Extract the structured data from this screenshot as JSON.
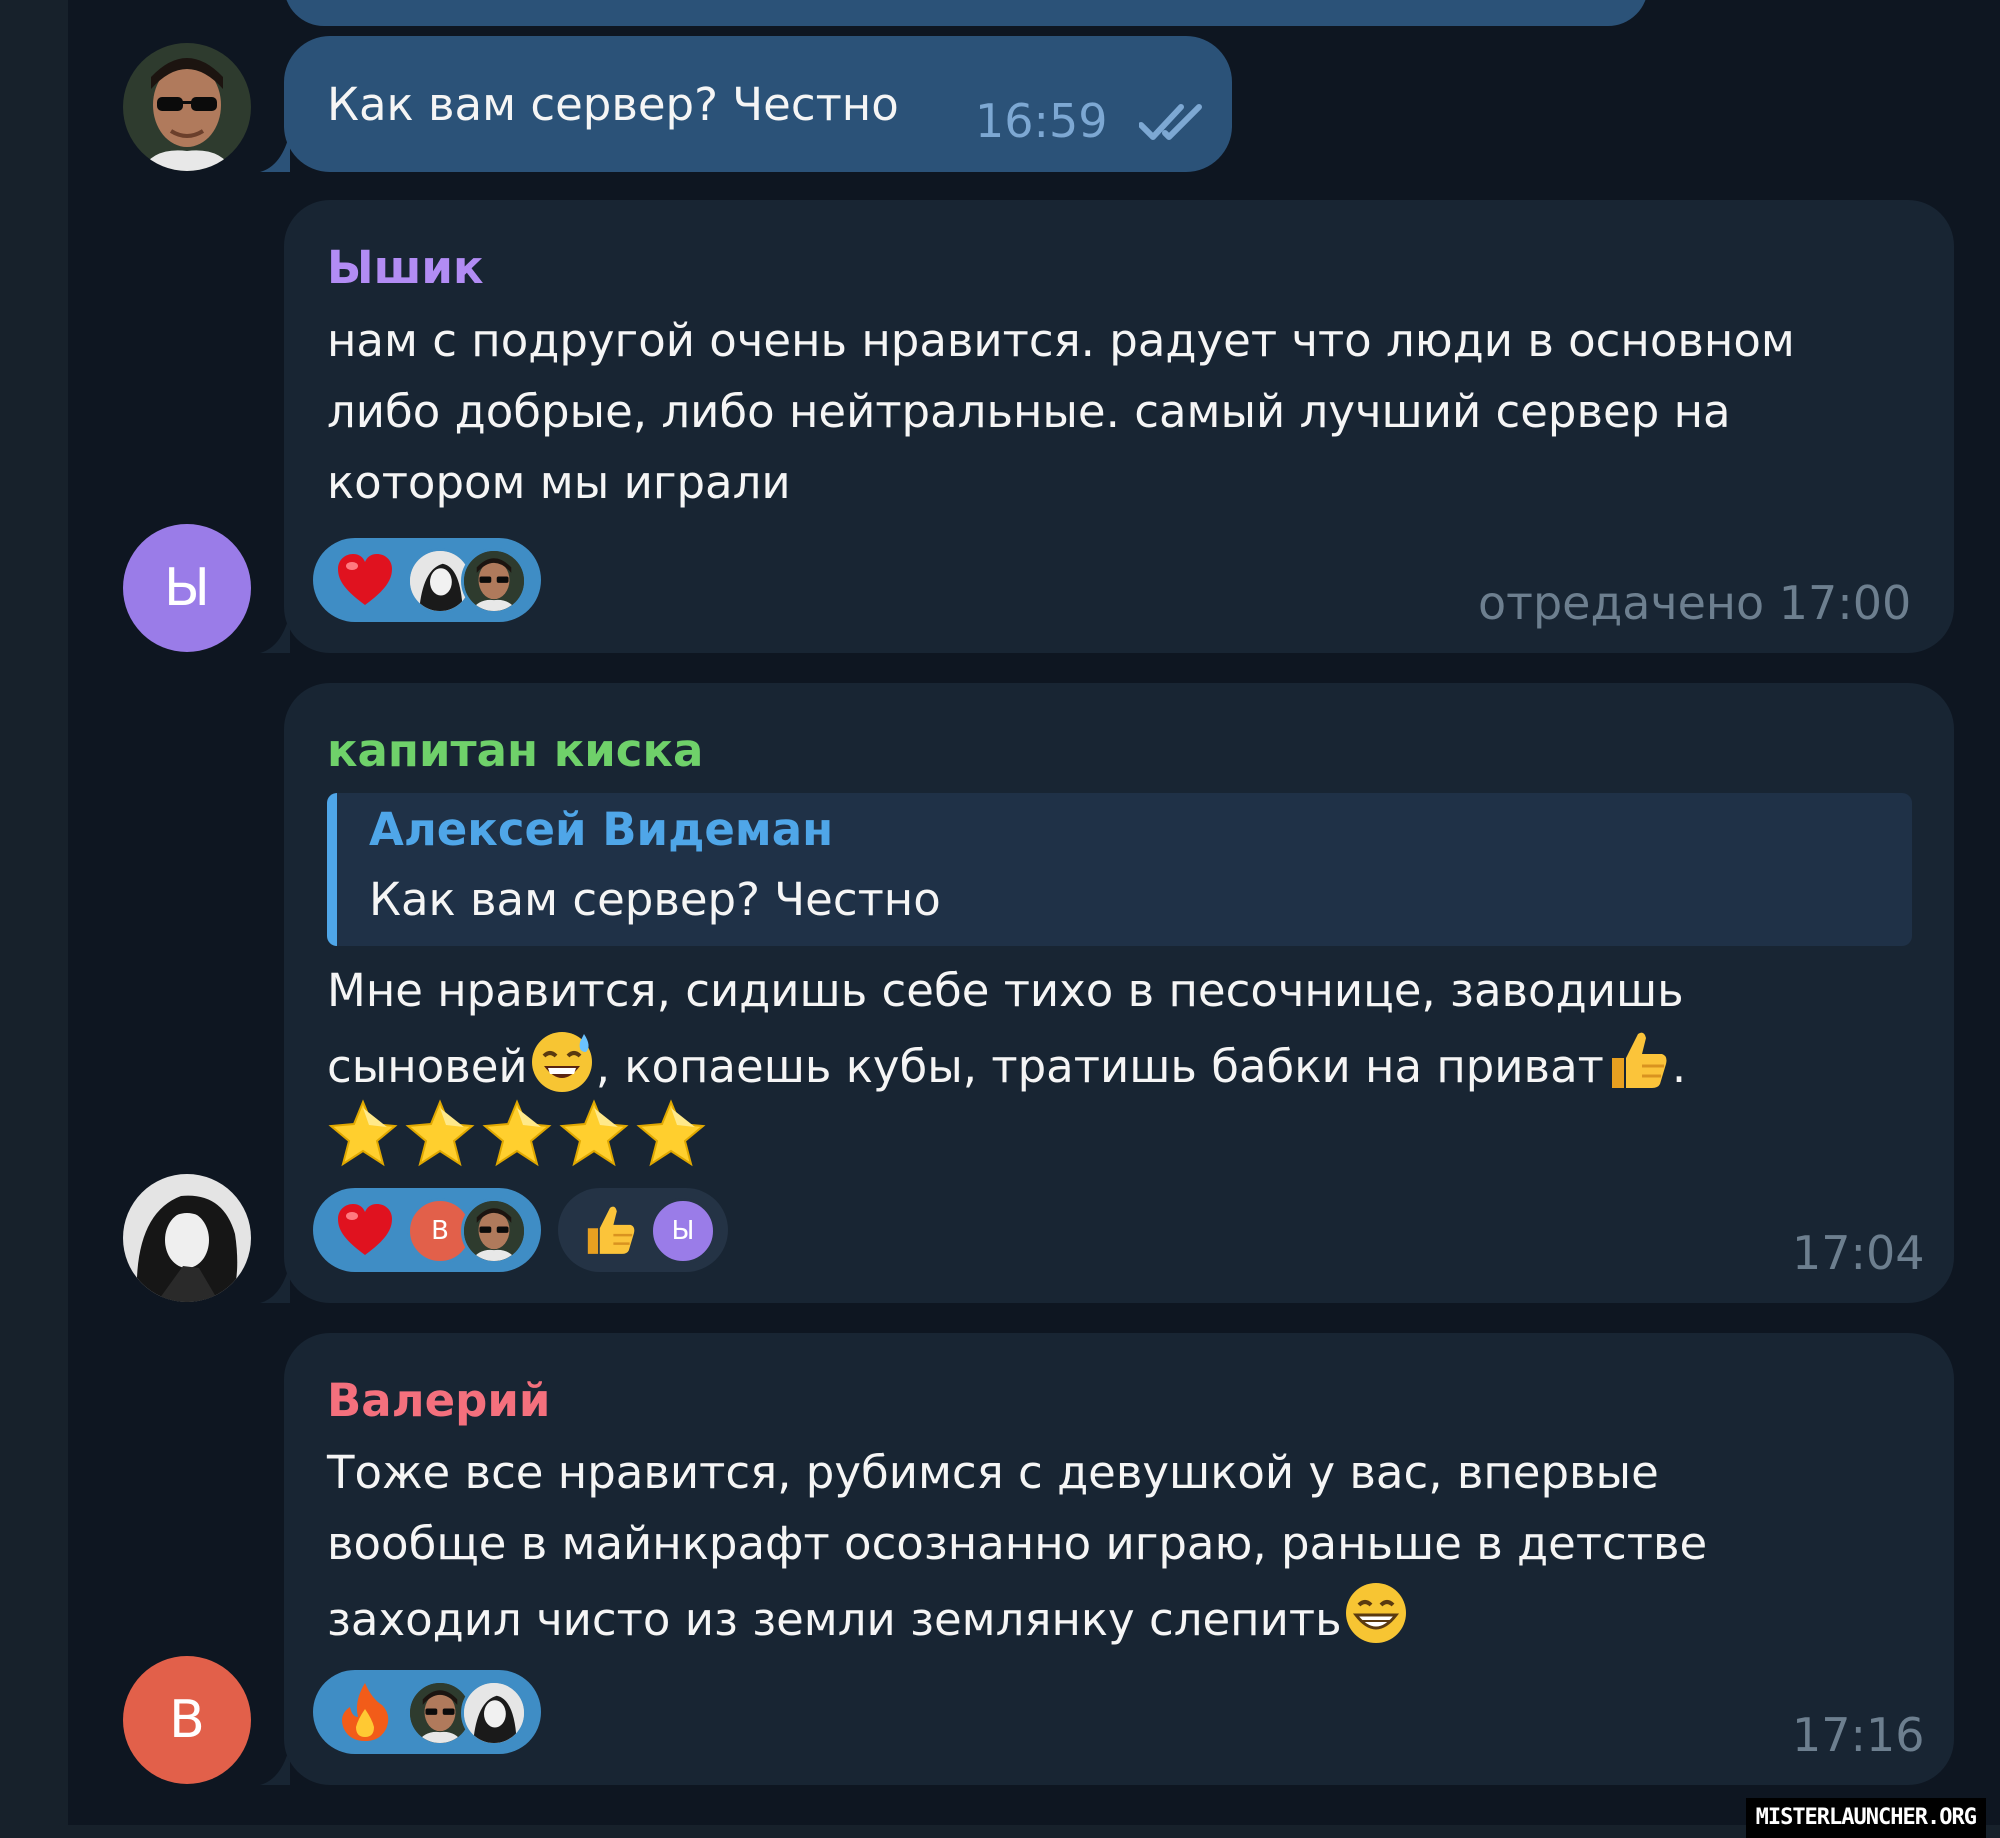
{
  "colors": {
    "background": "#0e1621",
    "outgoing_bubble": "#2b5278",
    "incoming_bubble": "#182533",
    "sender_purple": "#b28cf4",
    "sender_green": "#6fd16a",
    "sender_red": "#f4707d",
    "reply_accent": "#4fa6e8",
    "reaction_active": "#3f8dc5",
    "time_gray": "#6d7f8f"
  },
  "messages": [
    {
      "id": "out1",
      "text": "Как вам сервер? Честно",
      "time": "16:59",
      "status_icon": "double-check-icon"
    },
    {
      "id": "m1",
      "sender": "Ышик",
      "avatar_letter": "Ы",
      "lines": [
        "нам с подругой очень нравится. радует что люди в основном",
        "либо добрые, либо нейтральные. самый лучший сервер на",
        "котором мы играли"
      ],
      "reactions": [
        {
          "emoji": "heart-icon",
          "users": [
            "photo-bw",
            "photo-sunglasses"
          ]
        }
      ],
      "time": "отредачено 17:00"
    },
    {
      "id": "m2",
      "sender": "капитан киска",
      "reply": {
        "name": "Алексей Видеман",
        "text": "Как вам сервер? Честно"
      },
      "lines": [
        "Мне нравится, сидишь себе тихо в песочнице, заводишь",
        "сыновей",
        ", копаешь кубы, тратишь бабки на приват",
        "."
      ],
      "reactions": [
        {
          "emoji": "heart-icon",
          "users": [
            "В",
            "photo-sunglasses"
          ]
        },
        {
          "emoji": "thumbs-up-icon",
          "users": [
            "Ы"
          ]
        }
      ],
      "time": "17:04"
    },
    {
      "id": "m3",
      "sender": "Валерий",
      "avatar_letter": "В",
      "lines": [
        "Тоже все нравится, рубимся с девушкой у вас, впервые",
        "вообще в майнкрафт осознанно играю, раньше в детстве",
        "заходил чисто из земли землянку слепить"
      ],
      "reactions": [
        {
          "emoji": "fire-icon",
          "users": [
            "photo-sunglasses",
            "photo-bw"
          ]
        }
      ],
      "time": "17:16"
    }
  ],
  "watermark": "MISTERLAUNCHER.ORG"
}
